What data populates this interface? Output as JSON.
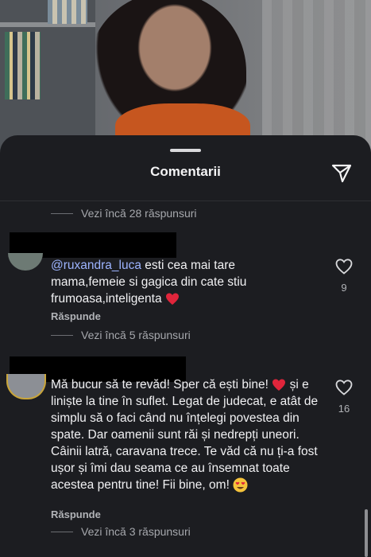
{
  "sheet": {
    "title": "Comentarii"
  },
  "thread_top": {
    "more_replies": "Vezi încă 28 răspunsuri"
  },
  "comments": [
    {
      "mention": "@ruxandra_luca",
      "text": " esti cea mai tare mama,femeie si gagica din cate stiu frumoasa,inteligenta",
      "reply_label": "Răspunde",
      "likes": "9",
      "more_replies": "Vezi încă 5 răspunsuri"
    },
    {
      "text": "Mă bucur să te revăd! Sper că ești bine!",
      "text_2": "și e liniște la tine în suflet. Legat de judecat, e atât de simplu să o faci când nu înțelegi povestea din spate. Dar oamenii sunt răi și nedrepți uneori. Câinii latră, caravana trece. Te văd că nu ți-a fost ușor și îmi dau seama ce au însemnat toate acestea pentru tine! Fii bine, om!",
      "reply_label": "Răspunde",
      "likes": "16",
      "more_replies": "Vezi încă 3 răspunsuri"
    }
  ],
  "colors": {
    "accent_mention": "#9db4ff",
    "heart": "#e0253b"
  },
  "icons": [
    "send-icon",
    "heart-outline-icon",
    "red-heart-emoji",
    "heart-eyes-emoji"
  ]
}
